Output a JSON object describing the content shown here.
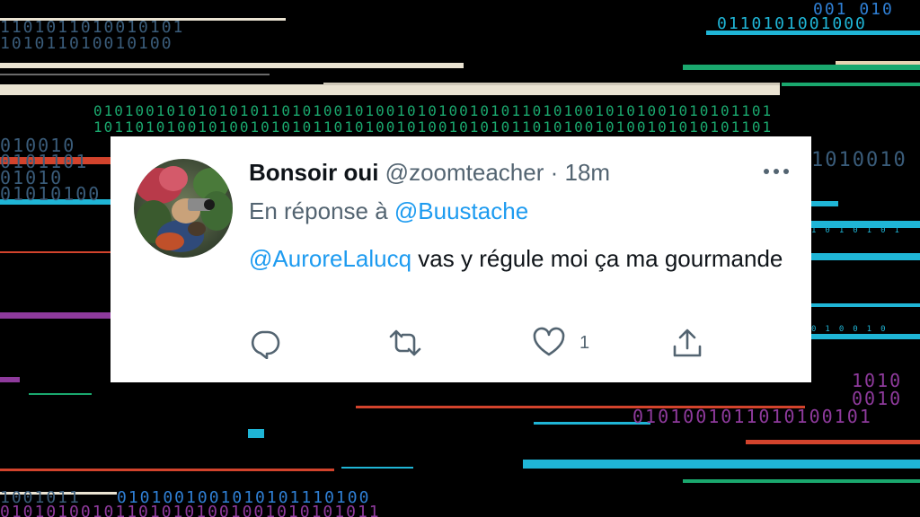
{
  "background": {
    "binary_strings": [
      "001 010",
      "0110101001000",
      "1101011010010101",
      "101011010010100",
      "01010010101010101101010010100101010010101101010010101001010101101",
      "10110101001010010101011010100101001010101101010010100101010101101",
      "010010",
      "0101101",
      "01010",
      "01010100",
      "1010010",
      "1010101",
      "010010",
      "1010",
      "0010",
      "0101001011010100101",
      "1001011",
      "0101001001010101110100",
      "010101001011010101001001010101011"
    ],
    "colors": {
      "cyan": "#1fb5d6",
      "cream": "#eae3d2",
      "green": "#1aa86e",
      "red": "#d2432c",
      "purple": "#8e3a9c",
      "blue": "#2f7fd4"
    }
  },
  "tweet": {
    "display_name": "Bonsoir oui",
    "handle": "@zoomteacher",
    "separator": "·",
    "time": "18m",
    "reply_prefix": "En réponse à",
    "reply_to": "@Buustache",
    "mention": "@AuroreLalucq",
    "body": "vas y régule moi ça ma gourmande",
    "like_count": "1",
    "avatar_icon": "avatar-image",
    "icons": [
      "more-icon",
      "reply-icon",
      "retweet-icon",
      "like-icon",
      "share-icon"
    ]
  }
}
